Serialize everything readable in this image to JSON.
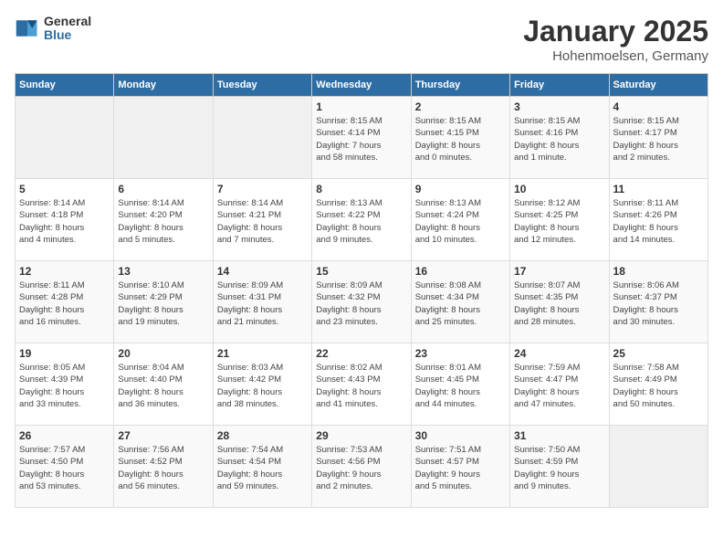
{
  "header": {
    "logo_general": "General",
    "logo_blue": "Blue",
    "month_title": "January 2025",
    "location": "Hohenmoelsen, Germany"
  },
  "weekdays": [
    "Sunday",
    "Monday",
    "Tuesday",
    "Wednesday",
    "Thursday",
    "Friday",
    "Saturday"
  ],
  "weeks": [
    [
      {
        "day": "",
        "info": ""
      },
      {
        "day": "",
        "info": ""
      },
      {
        "day": "",
        "info": ""
      },
      {
        "day": "1",
        "info": "Sunrise: 8:15 AM\nSunset: 4:14 PM\nDaylight: 7 hours\nand 58 minutes."
      },
      {
        "day": "2",
        "info": "Sunrise: 8:15 AM\nSunset: 4:15 PM\nDaylight: 8 hours\nand 0 minutes."
      },
      {
        "day": "3",
        "info": "Sunrise: 8:15 AM\nSunset: 4:16 PM\nDaylight: 8 hours\nand 1 minute."
      },
      {
        "day": "4",
        "info": "Sunrise: 8:15 AM\nSunset: 4:17 PM\nDaylight: 8 hours\nand 2 minutes."
      }
    ],
    [
      {
        "day": "5",
        "info": "Sunrise: 8:14 AM\nSunset: 4:18 PM\nDaylight: 8 hours\nand 4 minutes."
      },
      {
        "day": "6",
        "info": "Sunrise: 8:14 AM\nSunset: 4:20 PM\nDaylight: 8 hours\nand 5 minutes."
      },
      {
        "day": "7",
        "info": "Sunrise: 8:14 AM\nSunset: 4:21 PM\nDaylight: 8 hours\nand 7 minutes."
      },
      {
        "day": "8",
        "info": "Sunrise: 8:13 AM\nSunset: 4:22 PM\nDaylight: 8 hours\nand 9 minutes."
      },
      {
        "day": "9",
        "info": "Sunrise: 8:13 AM\nSunset: 4:24 PM\nDaylight: 8 hours\nand 10 minutes."
      },
      {
        "day": "10",
        "info": "Sunrise: 8:12 AM\nSunset: 4:25 PM\nDaylight: 8 hours\nand 12 minutes."
      },
      {
        "day": "11",
        "info": "Sunrise: 8:11 AM\nSunset: 4:26 PM\nDaylight: 8 hours\nand 14 minutes."
      }
    ],
    [
      {
        "day": "12",
        "info": "Sunrise: 8:11 AM\nSunset: 4:28 PM\nDaylight: 8 hours\nand 16 minutes."
      },
      {
        "day": "13",
        "info": "Sunrise: 8:10 AM\nSunset: 4:29 PM\nDaylight: 8 hours\nand 19 minutes."
      },
      {
        "day": "14",
        "info": "Sunrise: 8:09 AM\nSunset: 4:31 PM\nDaylight: 8 hours\nand 21 minutes."
      },
      {
        "day": "15",
        "info": "Sunrise: 8:09 AM\nSunset: 4:32 PM\nDaylight: 8 hours\nand 23 minutes."
      },
      {
        "day": "16",
        "info": "Sunrise: 8:08 AM\nSunset: 4:34 PM\nDaylight: 8 hours\nand 25 minutes."
      },
      {
        "day": "17",
        "info": "Sunrise: 8:07 AM\nSunset: 4:35 PM\nDaylight: 8 hours\nand 28 minutes."
      },
      {
        "day": "18",
        "info": "Sunrise: 8:06 AM\nSunset: 4:37 PM\nDaylight: 8 hours\nand 30 minutes."
      }
    ],
    [
      {
        "day": "19",
        "info": "Sunrise: 8:05 AM\nSunset: 4:39 PM\nDaylight: 8 hours\nand 33 minutes."
      },
      {
        "day": "20",
        "info": "Sunrise: 8:04 AM\nSunset: 4:40 PM\nDaylight: 8 hours\nand 36 minutes."
      },
      {
        "day": "21",
        "info": "Sunrise: 8:03 AM\nSunset: 4:42 PM\nDaylight: 8 hours\nand 38 minutes."
      },
      {
        "day": "22",
        "info": "Sunrise: 8:02 AM\nSunset: 4:43 PM\nDaylight: 8 hours\nand 41 minutes."
      },
      {
        "day": "23",
        "info": "Sunrise: 8:01 AM\nSunset: 4:45 PM\nDaylight: 8 hours\nand 44 minutes."
      },
      {
        "day": "24",
        "info": "Sunrise: 7:59 AM\nSunset: 4:47 PM\nDaylight: 8 hours\nand 47 minutes."
      },
      {
        "day": "25",
        "info": "Sunrise: 7:58 AM\nSunset: 4:49 PM\nDaylight: 8 hours\nand 50 minutes."
      }
    ],
    [
      {
        "day": "26",
        "info": "Sunrise: 7:57 AM\nSunset: 4:50 PM\nDaylight: 8 hours\nand 53 minutes."
      },
      {
        "day": "27",
        "info": "Sunrise: 7:56 AM\nSunset: 4:52 PM\nDaylight: 8 hours\nand 56 minutes."
      },
      {
        "day": "28",
        "info": "Sunrise: 7:54 AM\nSunset: 4:54 PM\nDaylight: 8 hours\nand 59 minutes."
      },
      {
        "day": "29",
        "info": "Sunrise: 7:53 AM\nSunset: 4:56 PM\nDaylight: 9 hours\nand 2 minutes."
      },
      {
        "day": "30",
        "info": "Sunrise: 7:51 AM\nSunset: 4:57 PM\nDaylight: 9 hours\nand 5 minutes."
      },
      {
        "day": "31",
        "info": "Sunrise: 7:50 AM\nSunset: 4:59 PM\nDaylight: 9 hours\nand 9 minutes."
      },
      {
        "day": "",
        "info": ""
      }
    ]
  ]
}
